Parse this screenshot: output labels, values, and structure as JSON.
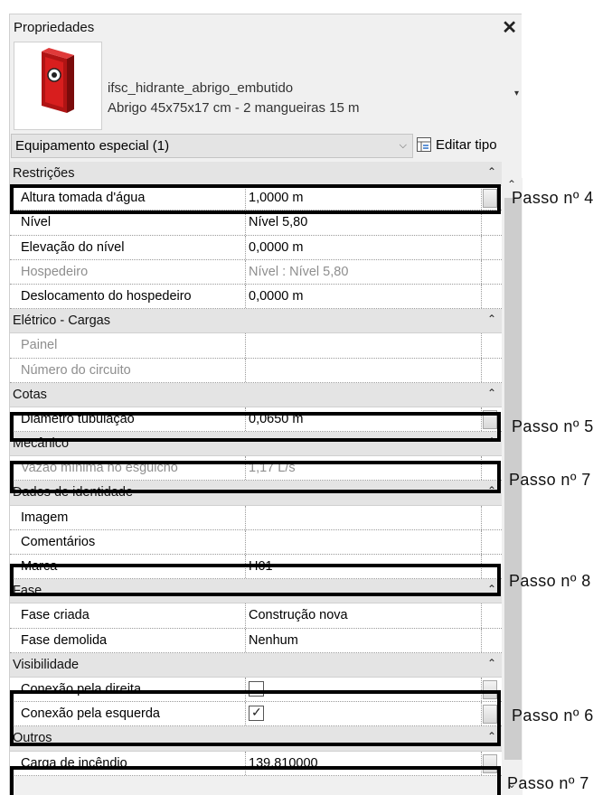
{
  "panel": {
    "title": "Propriedades",
    "close_icon": "close-icon",
    "family_name": "ifsc_hidrante_abrigo_embutido",
    "family_type": "Abrigo 45x75x17 cm - 2 mangueiras 15 m",
    "type_arrow": "▾",
    "selector": "Equipamento especial (1)",
    "selector_chevron": "⌵",
    "edit_type": "Editar tipo",
    "colors": {
      "hydrant_red": "#d81e1e",
      "group_bg": "#e4e4e4",
      "highlight": "#000000"
    }
  },
  "groups": [
    {
      "title": "Restrições",
      "rows": [
        {
          "name": "Altura tomada d'água",
          "value": "1,0000 m"
        },
        {
          "name": "Nível",
          "value": "Nível 5,80"
        },
        {
          "name": "Elevação do nível",
          "value": "0,0000 m"
        },
        {
          "name": "Hospedeiro",
          "value": "Nível : Nível 5,80"
        },
        {
          "name": "Deslocamento do hospedeiro",
          "value": "0,0000 m"
        }
      ]
    },
    {
      "title": "Elétrico - Cargas",
      "rows": [
        {
          "name": "Painel",
          "value": ""
        },
        {
          "name": "Número do circuito",
          "value": ""
        }
      ]
    },
    {
      "title": "Cotas",
      "rows": [
        {
          "name": "Diâmetro tubulação",
          "value": "0,0650 m"
        }
      ]
    },
    {
      "title": "Mecânico",
      "rows": [
        {
          "name": "Vazão mínima no esguicho",
          "value": "1,17 L/s"
        }
      ]
    },
    {
      "title": "Dados de identidade",
      "rows": [
        {
          "name": "Imagem",
          "value": ""
        },
        {
          "name": "Comentários",
          "value": ""
        },
        {
          "name": "Marca",
          "value": "H01"
        }
      ]
    },
    {
      "title": "Fase",
      "rows": [
        {
          "name": "Fase criada",
          "value": "Construção nova"
        },
        {
          "name": "Fase demolida",
          "value": "Nenhum"
        }
      ]
    },
    {
      "title": "Visibilidade",
      "rows": [
        {
          "name": "Conexão pela direita",
          "checked": false
        },
        {
          "name": "Conexão pela esquerda",
          "checked": true
        }
      ]
    },
    {
      "title": "Outros",
      "rows": [
        {
          "name": "Carga de incêndio",
          "value": "139,810000"
        }
      ]
    }
  ],
  "group_caret": "⌃",
  "check_mark": "✓",
  "scroll": {
    "up": "⌃",
    "down": "⌄"
  },
  "steps": {
    "altura": "Passo nº 4",
    "diametro": "Passo nº 5",
    "vazao": "Passo nº 7",
    "marca": "Passo nº 8",
    "visibilidade": "Passo nº 6",
    "carga": "Passo nº 7"
  }
}
